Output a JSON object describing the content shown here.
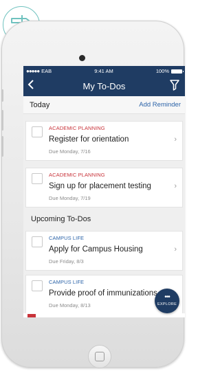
{
  "status_bar": {
    "carrier": "EAB",
    "time": "9:41 AM",
    "battery": "100%"
  },
  "nav": {
    "title": "My To-Dos",
    "back_icon": "chevron-left-icon",
    "filter_icon": "filter-icon"
  },
  "today": {
    "heading": "Today",
    "add_reminder": "Add Reminder",
    "items": [
      {
        "category": "ACADEMIC PLANNING",
        "title": "Register for orientation",
        "due": "Due Monday, 7/16"
      },
      {
        "category": "ACADEMIC PLANNING",
        "title": "Sign up for placement testing",
        "due": "Due Monday, 7/19"
      }
    ]
  },
  "upcoming": {
    "heading": "Upcoming To-Dos",
    "items": [
      {
        "category": "CAMPUS LIFE",
        "title": "Apply for Campus Housing",
        "due": "Due Friday, 8/3"
      },
      {
        "category": "CAMPUS LIFE",
        "title": "Provide proof of immunizations",
        "due": "Due Monday, 8/13"
      }
    ]
  },
  "explore": {
    "dots": "•••",
    "label": "EXPLORE"
  },
  "colors": {
    "navy": "#1f3c63",
    "academic": "#c8333a",
    "campus": "#2b63a8",
    "badge_outline": "#6fc2bf"
  }
}
